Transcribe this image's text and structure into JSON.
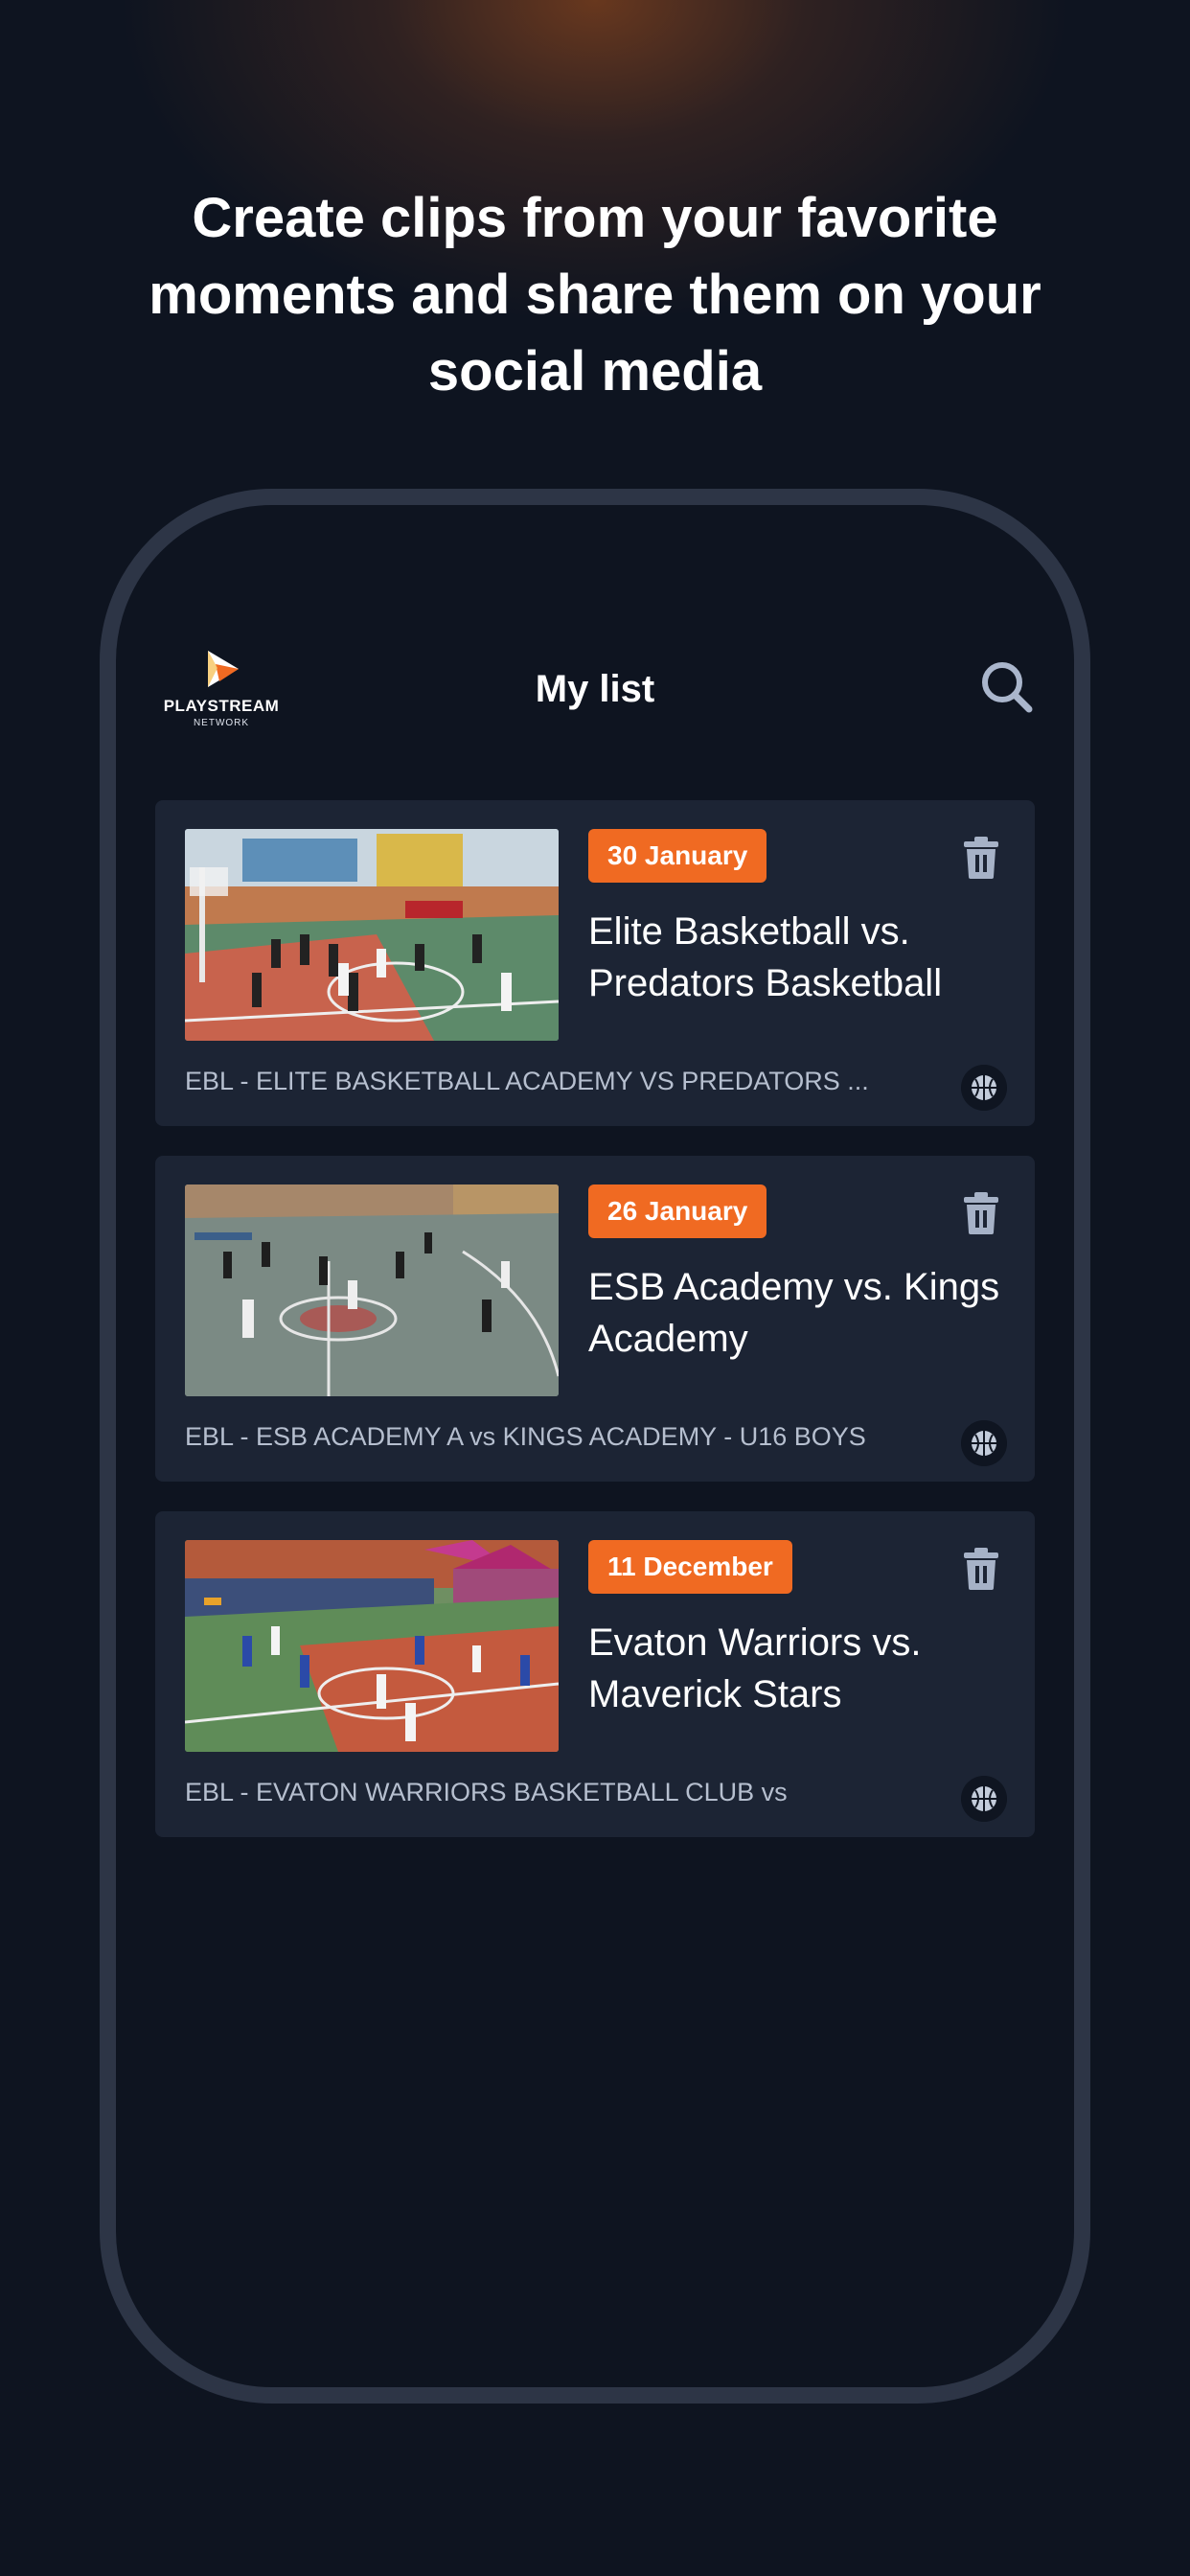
{
  "headline": "Create clips from your favorite moments and share them on your social media",
  "app": {
    "logo_text": "PLAYSTREAM",
    "logo_subtext": "NETWORK",
    "screen_title": "My list",
    "search_icon": "search-icon"
  },
  "colors": {
    "accent": "#f06a22",
    "background": "#0e1420",
    "card": "#1c2434",
    "phone_frame": "#2d3546"
  },
  "clips": [
    {
      "date": "30 January",
      "title": "Elite Basketball vs. Predators Basketball",
      "subtitle": "EBL - ELITE BASKETBALL ACADEMY VS PREDATORS ...",
      "sport_icon": "basketball-icon",
      "action_icon": "trash-icon"
    },
    {
      "date": "26 January",
      "title": "ESB Academy vs. Kings Academy",
      "subtitle": "EBL - ESB ACADEMY A vs KINGS ACADEMY - U16 BOYS",
      "sport_icon": "basketball-icon",
      "action_icon": "trash-icon"
    },
    {
      "date": "11 December",
      "title": "Evaton Warriors vs. Maverick Stars",
      "subtitle": "EBL - EVATON WARRIORS BASKETBALL CLUB vs",
      "sport_icon": "basketball-icon",
      "action_icon": "trash-icon"
    }
  ]
}
